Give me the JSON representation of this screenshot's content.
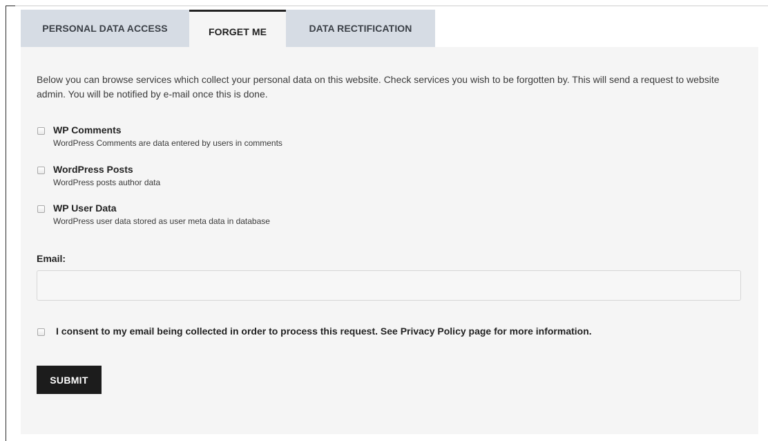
{
  "tabs": [
    {
      "label": "PERSONAL DATA ACCESS",
      "active": false
    },
    {
      "label": "FORGET ME",
      "active": true
    },
    {
      "label": "DATA RECTIFICATION",
      "active": false
    }
  ],
  "intro": "Below you can browse services which collect your personal data on this website. Check services you wish to be forgotten by. This will send a request to website admin. You will be notified by e-mail once this is done.",
  "services": [
    {
      "title": "WP Comments",
      "description": "WordPress Comments are data entered by users in comments",
      "checked": false
    },
    {
      "title": "WordPress Posts",
      "description": "WordPress posts author data",
      "checked": false
    },
    {
      "title": "WP User Data",
      "description": "WordPress user data stored as user meta data in database",
      "checked": false
    }
  ],
  "email": {
    "label": "Email:",
    "value": "",
    "placeholder": ""
  },
  "consent": {
    "text": "I consent to my email being collected in order to process this request. See Privacy Policy page for more information.",
    "checked": false
  },
  "submit_label": "SUBMIT",
  "colors": {
    "tab_inactive_bg": "#d6dce4",
    "panel_bg": "#f5f5f5",
    "button_bg": "#1c1c1c"
  }
}
